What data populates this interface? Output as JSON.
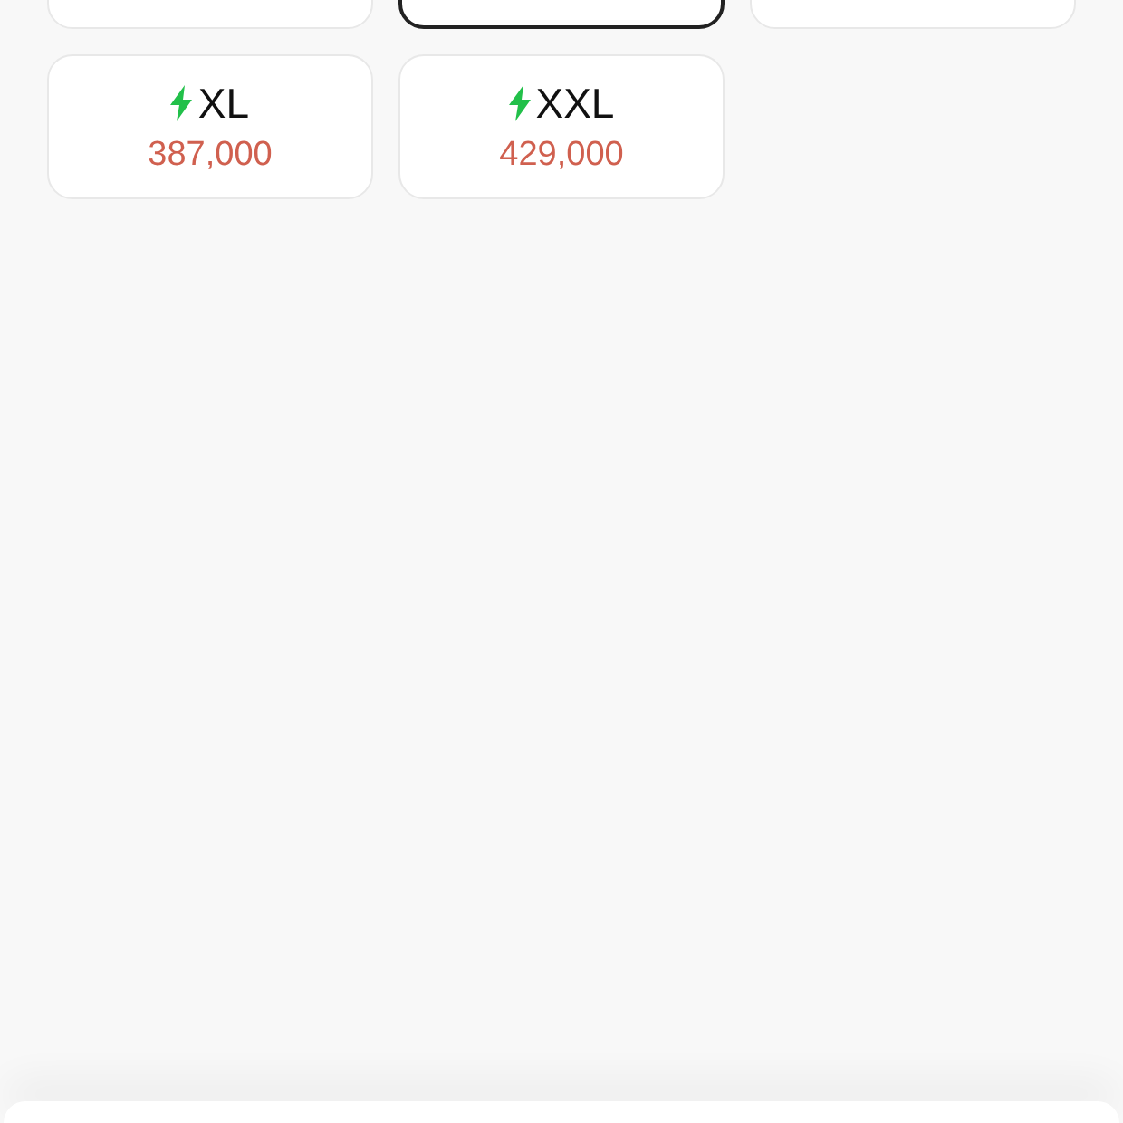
{
  "size_options": [
    {
      "selected": false
    },
    {
      "selected": true
    },
    {
      "selected": false
    },
    {
      "label": "XL",
      "price": "387,000",
      "selected": false
    },
    {
      "label": "XXL",
      "price": "429,000",
      "selected": false
    }
  ]
}
